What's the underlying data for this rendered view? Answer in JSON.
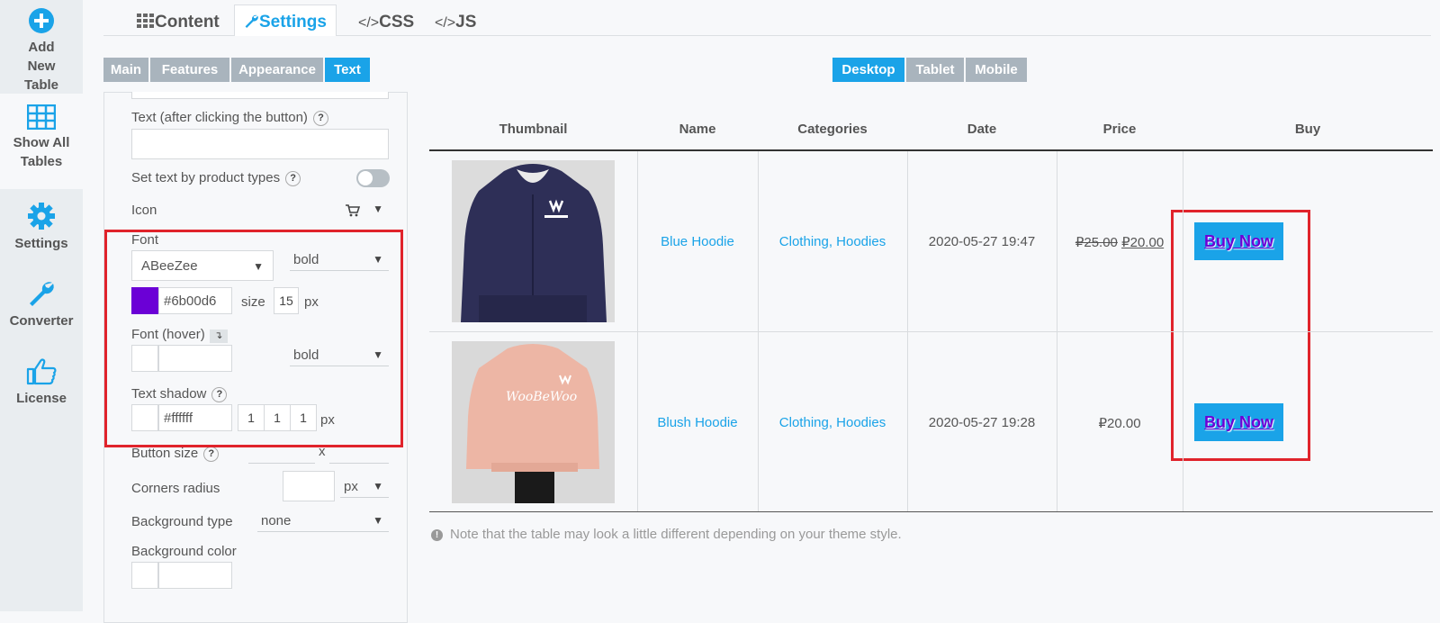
{
  "leftnav": {
    "items": [
      {
        "label": "Add New Table",
        "icon": "plus-circle-icon"
      },
      {
        "label": "Show All Tables",
        "icon": "table-grid-icon"
      },
      {
        "label": "Settings",
        "icon": "gear-icon"
      },
      {
        "label": "Converter",
        "icon": "wrench-icon"
      },
      {
        "label": "License",
        "icon": "thumbs-up-icon"
      }
    ]
  },
  "top_tabs": [
    {
      "label": "Content",
      "icon": "grid-icon"
    },
    {
      "label": "Settings",
      "icon": "wrench-icon"
    },
    {
      "label": "CSS",
      "icon": "code-icon"
    },
    {
      "label": "JS",
      "icon": "code-icon"
    }
  ],
  "sub_tabs": [
    "Main",
    "Features",
    "Appearance",
    "Text"
  ],
  "device_tabs": [
    "Desktop",
    "Tablet",
    "Mobile"
  ],
  "panel": {
    "text_after_click_label": "Text (after clicking the button)",
    "set_text_by_types_label": "Set text by product types",
    "icon_label": "Icon",
    "font_label": "Font",
    "font_family": "ABeeZee",
    "font_weight": "bold",
    "font_color": "#6b00d6",
    "size_label": "size",
    "font_size": "15",
    "px": "px",
    "font_hover_label": "Font (hover)",
    "hover_weight": "bold",
    "text_shadow_label": "Text shadow",
    "shadow_color": "#ffffff",
    "shadow_values": [
      "1",
      "1",
      "1"
    ],
    "button_size_label": "Button size",
    "button_size_x": "x",
    "corners_radius_label": "Corners radius",
    "corners_unit": "px",
    "background_type_label": "Background type",
    "background_type": "none",
    "background_color_label": "Background color",
    "help": "?"
  },
  "table": {
    "headers": [
      "Thumbnail",
      "Name",
      "Categories",
      "Date",
      "Price",
      "Buy"
    ],
    "rows": [
      {
        "name": "Blue Hoodie",
        "categories": "Clothing, Hoodies",
        "date": "2020-05-27 19:47",
        "price_old": "₽25.00",
        "price": "₽20.00",
        "buy": "Buy Now"
      },
      {
        "name": "Blush Hoodie",
        "categories": "Clothing, Hoodies",
        "date": "2020-05-27 19:28",
        "price_old": "",
        "price": "₽20.00",
        "buy": "Buy Now"
      }
    ]
  },
  "note": "Note that the table may look a little different depending on your theme style.",
  "colors": {
    "accent": "#1aa3e8",
    "font_color": "#6b00d6",
    "highlight": "#e0232b"
  }
}
